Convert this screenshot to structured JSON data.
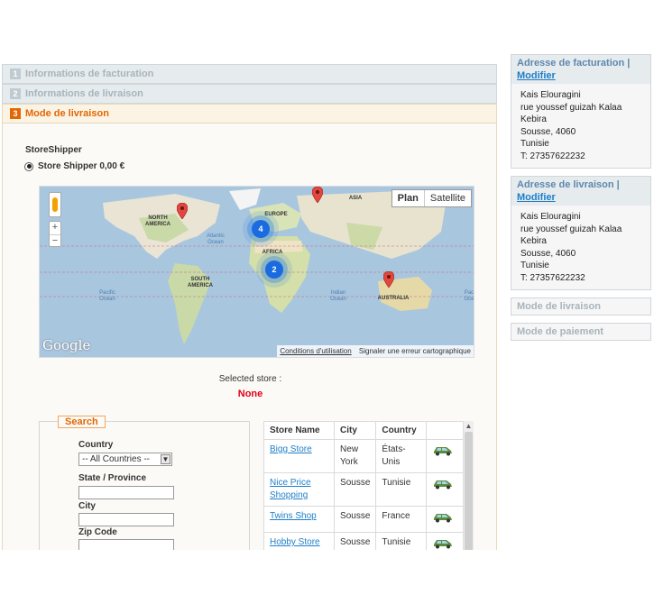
{
  "steps": [
    {
      "num": "1",
      "label": "Informations de facturation"
    },
    {
      "num": "2",
      "label": "Informations de livraison"
    },
    {
      "num": "3",
      "label": "Mode de livraison"
    }
  ],
  "shipping": {
    "group_title": "StoreShipper",
    "option_label": "Store Shipper 0,00 €"
  },
  "map": {
    "type_plan": "Plan",
    "type_satellite": "Satellite",
    "logo": "Google",
    "terms": "Conditions d'utilisation",
    "report": "Signaler une erreur cartographique",
    "zoom_in": "+",
    "zoom_out": "−",
    "labels": {
      "north_america": "NORTH AMERICA",
      "south_america": "SOUTH AMERICA",
      "europe": "EUROPE",
      "asia": "ASIA",
      "africa": "AFRICA",
      "australia": "AUSTRALIA",
      "atlantic": "Atlantic Ocean",
      "pacific_left": "Pacific Ocean",
      "indian": "Indian Ocean",
      "pacific_right": "Pac Oce"
    },
    "clusters": [
      {
        "count": "4"
      },
      {
        "count": "2"
      }
    ]
  },
  "selected": {
    "label": "Selected store :",
    "value": "None"
  },
  "search": {
    "legend": "Search",
    "country_label": "Country",
    "country_value": "-- All Countries --",
    "state_label": "State / Province",
    "city_label": "City",
    "zip_label": "Zip Code"
  },
  "stores": {
    "headers": [
      "Store Name",
      "City",
      "Country"
    ],
    "rows": [
      {
        "name": "Bigg Store",
        "city": "New York",
        "country": "États-Unis"
      },
      {
        "name": "Nice Price Shopping",
        "city": "Sousse",
        "country": "Tunisie"
      },
      {
        "name": "Twins Shop",
        "city": "Sousse",
        "country": "France"
      },
      {
        "name": "Hobby Store",
        "city": "Sousse",
        "country": "Tunisie"
      }
    ]
  },
  "sidebar": {
    "billing": {
      "title": "Adresse de facturation",
      "edit": "Modifier",
      "lines": [
        "Kais Elouragini",
        "rue youssef guizah Kalaa",
        "Kebira",
        "Sousse, 4060",
        "Tunisie",
        "T: 27357622232"
      ]
    },
    "shipping": {
      "title": "Adresse de livraison",
      "edit": "Modifier",
      "lines": [
        "Kais Elouragini",
        "rue youssef guizah Kalaa",
        "Kebira",
        "Sousse, 4060",
        "Tunisie",
        "T: 27357622232"
      ]
    },
    "shipping_method": "Mode de livraison",
    "payment_method": "Mode de paiement"
  }
}
